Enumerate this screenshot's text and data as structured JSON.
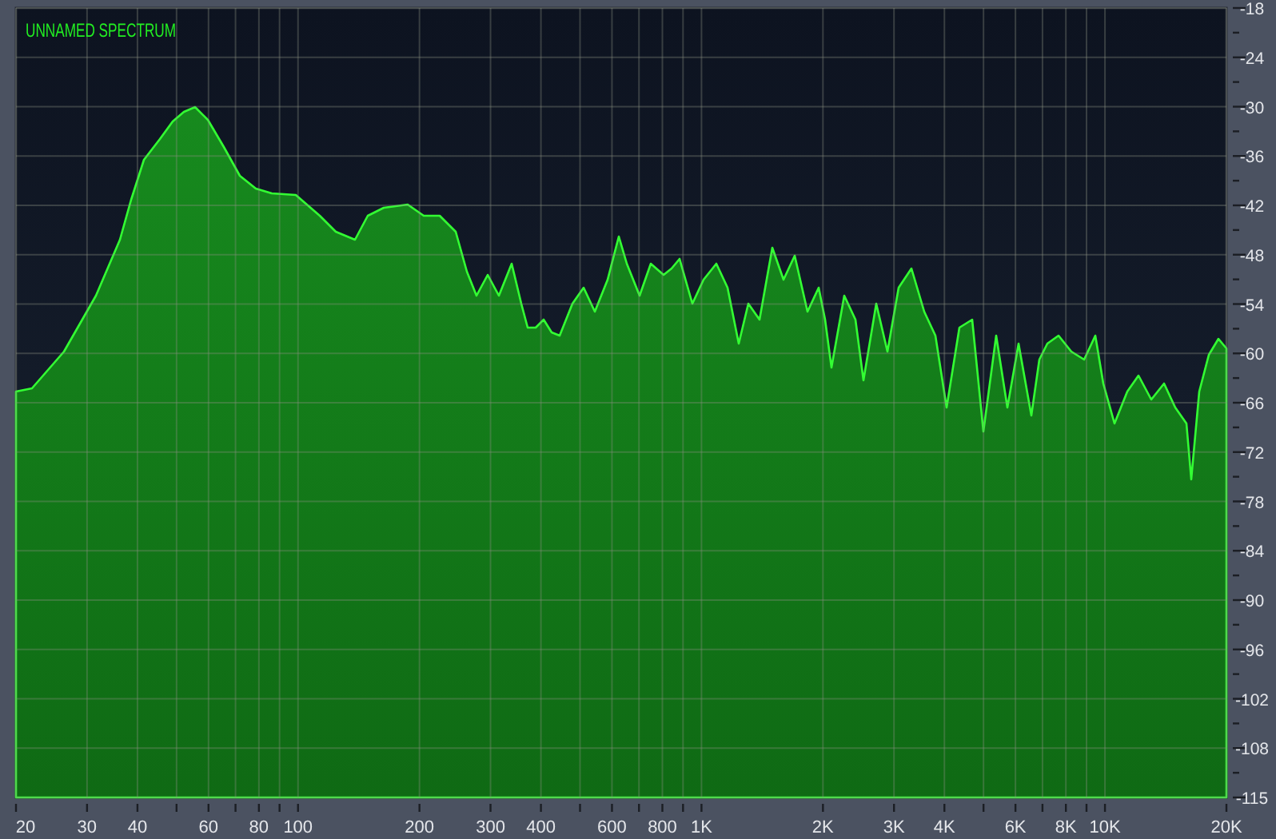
{
  "spectrum": {
    "title": "UNNAMED SPECTRUM",
    "x_axis_labels": [
      "20",
      "30",
      "40",
      "60",
      "80",
      "100",
      "200",
      "300",
      "400",
      "600",
      "800",
      "1K",
      "2K",
      "3K",
      "4K",
      "6K",
      "8K",
      "10K",
      "20K"
    ],
    "y_axis_labels": [
      "-18",
      "-24",
      "-30",
      "-36",
      "-42",
      "-48",
      "-54",
      "-60",
      "-66",
      "-72",
      "-78",
      "-84",
      "-90",
      "-96",
      "-102",
      "-108",
      "-115"
    ]
  }
}
